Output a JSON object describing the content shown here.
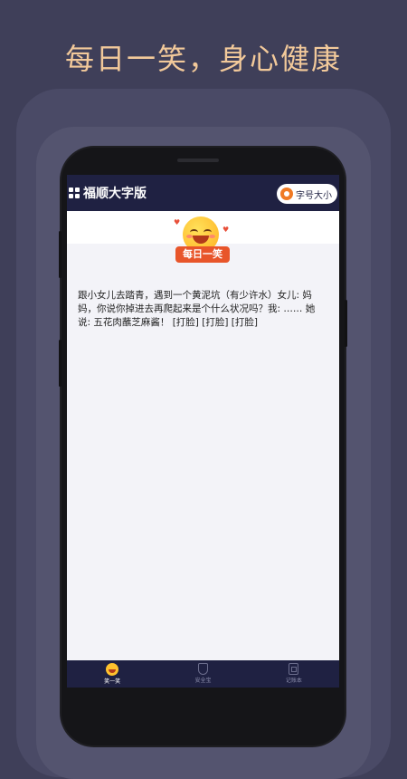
{
  "headline": "每日一笑，身心健康",
  "app": {
    "title": "福顺大字版",
    "font_size_button": "字号大小"
  },
  "banner": {
    "tag": "每日一笑"
  },
  "joke": "跟小女儿去踏青，遇到一个黄泥坑（有少许水）女儿: 妈妈，你说你掉进去再爬起来是个什么状况吗？我: ……   她说: 五花肉蘸芝麻酱！ [打脸] [打脸] [打脸]",
  "tabs": [
    {
      "label": "笑一笑",
      "icon": "smile-face-icon",
      "active": true
    },
    {
      "label": "安全宝",
      "icon": "shield-icon",
      "active": false
    },
    {
      "label": "记账本",
      "icon": "notebook-icon",
      "active": false
    }
  ],
  "colors": {
    "background": "#3f3f59",
    "headline": "#f2c99a",
    "topbar": "#1f2142",
    "accent": "#e8552a"
  }
}
